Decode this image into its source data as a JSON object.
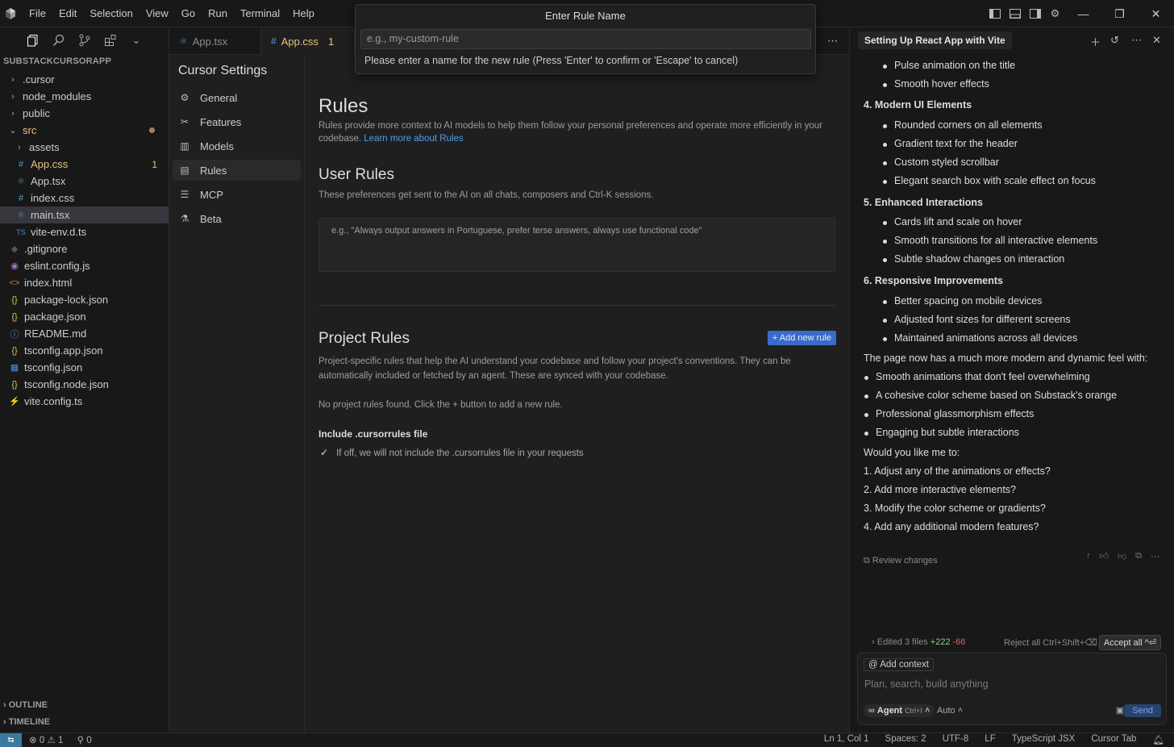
{
  "menu": [
    "File",
    "Edit",
    "Selection",
    "View",
    "Go",
    "Run",
    "Terminal",
    "Help"
  ],
  "explorer": {
    "title": "SUBSTACKCURSORAPP",
    "items": [
      {
        "label": ".cursor",
        "type": "folder",
        "level": 0,
        "icon": "chevron-right"
      },
      {
        "label": "node_modules",
        "type": "folder",
        "level": 0,
        "icon": "chevron-right"
      },
      {
        "label": "public",
        "type": "folder",
        "level": 0,
        "icon": "chevron-right"
      },
      {
        "label": "src",
        "type": "folder-open",
        "level": 0,
        "icon": "chevron-down",
        "color": "#e8c07d"
      },
      {
        "label": "assets",
        "type": "folder",
        "level": 1,
        "icon": "chevron-right"
      },
      {
        "label": "App.css",
        "type": "css",
        "level": 1,
        "badge": "1",
        "color": "#e8c07d"
      },
      {
        "label": "App.tsx",
        "type": "react",
        "level": 1
      },
      {
        "label": "index.css",
        "type": "css",
        "level": 1
      },
      {
        "label": "main.tsx",
        "type": "react",
        "level": 1,
        "selected": true
      },
      {
        "label": "vite-env.d.ts",
        "type": "ts",
        "level": 1
      },
      {
        "label": ".gitignore",
        "type": "git",
        "level": 0
      },
      {
        "label": "eslint.config.js",
        "type": "eslint",
        "level": 0
      },
      {
        "label": "index.html",
        "type": "html",
        "level": 0
      },
      {
        "label": "package-lock.json",
        "type": "json",
        "level": 0
      },
      {
        "label": "package.json",
        "type": "json",
        "level": 0
      },
      {
        "label": "README.md",
        "type": "info",
        "level": 0
      },
      {
        "label": "tsconfig.app.json",
        "type": "json",
        "level": 0
      },
      {
        "label": "tsconfig.json",
        "type": "tsjson",
        "level": 0
      },
      {
        "label": "tsconfig.node.json",
        "type": "json",
        "level": 0
      },
      {
        "label": "vite.config.ts",
        "type": "vite",
        "level": 0
      }
    ],
    "outline": "OUTLINE",
    "timeline": "TIMELINE"
  },
  "tabs": [
    {
      "label": "App.tsx",
      "active": false
    },
    {
      "label": "App.css",
      "badge": "1",
      "active": true
    }
  ],
  "settings": {
    "title": "Cursor Settings",
    "nav": [
      {
        "label": "General",
        "icon": "gear-icon"
      },
      {
        "label": "Features",
        "icon": "tools-icon"
      },
      {
        "label": "Models",
        "icon": "chart-icon"
      },
      {
        "label": "Rules",
        "icon": "document-icon",
        "active": true
      },
      {
        "label": "MCP",
        "icon": "server-icon"
      },
      {
        "label": "Beta",
        "icon": "flask-icon"
      }
    ],
    "rules_heading": "Rules",
    "rules_desc": "Rules provide more context to AI models to help them follow your personal preferences and operate more efficiently in your codebase.",
    "rules_link": "Learn more about Rules",
    "user_rules_heading": "User Rules",
    "user_rules_desc": "These preferences get sent to the AI on all chats, composers and Ctrl-K sessions.",
    "user_rules_placeholder": "e.g., \"Always output answers in Portuguese, prefer terse answers, always use functional code\"",
    "project_rules_heading": "Project Rules",
    "add_rule_label": "+ Add new rule",
    "project_rules_desc": "Project-specific rules that help the AI understand your codebase and follow your project's conventions. They can be automatically included or fetched by an agent. These are synced with your codebase.",
    "no_rules": "No project rules found. Click the + button to add a new rule.",
    "include_heading": "Include .cursorrules file",
    "include_desc": "If off, we will not include the .cursorrules file in your requests"
  },
  "dialog": {
    "title": "Enter Rule Name",
    "placeholder": "e.g., my-custom-rule",
    "message": "Please enter a name for the new rule (Press 'Enter' to confirm or 'Escape' to cancel)"
  },
  "chat": {
    "title": "Setting Up React App with Vite",
    "lines": [
      {
        "kind": "bullet",
        "text": "Pulse animation on the title"
      },
      {
        "kind": "bullet",
        "text": "Smooth hover effects"
      },
      {
        "kind": "head",
        "text": "4. Modern UI Elements"
      },
      {
        "kind": "bullet",
        "text": "Rounded corners on all elements"
      },
      {
        "kind": "bullet",
        "text": "Gradient text for the header"
      },
      {
        "kind": "bullet",
        "text": "Custom styled scrollbar"
      },
      {
        "kind": "bullet",
        "text": "Elegant search box with scale effect on focus"
      },
      {
        "kind": "head",
        "text": "5. Enhanced Interactions"
      },
      {
        "kind": "bullet",
        "text": "Cards lift and scale on hover"
      },
      {
        "kind": "bullet",
        "text": "Smooth transitions for all interactive elements"
      },
      {
        "kind": "bullet",
        "text": "Subtle shadow changes on interaction"
      },
      {
        "kind": "head",
        "text": "6. Responsive Improvements"
      },
      {
        "kind": "bullet",
        "text": "Better spacing on mobile devices"
      },
      {
        "kind": "bullet",
        "text": "Adjusted font sizes for different screens"
      },
      {
        "kind": "bullet",
        "text": "Maintained animations across all devices"
      },
      {
        "kind": "text",
        "text": "The page now has a much more modern and dynamic feel with:"
      },
      {
        "kind": "bullet0",
        "text": "Smooth animations that don't feel overwhelming"
      },
      {
        "kind": "bullet0",
        "text": "A cohesive color scheme based on Substack's orange"
      },
      {
        "kind": "bullet0",
        "text": "Professional glassmorphism effects"
      },
      {
        "kind": "bullet0",
        "text": "Engaging but subtle interactions"
      },
      {
        "kind": "text",
        "text": "Would you like me to:"
      },
      {
        "kind": "num",
        "text": "1. Adjust any of the animations or effects?"
      },
      {
        "kind": "num",
        "text": "2. Add more interactive elements?"
      },
      {
        "kind": "num",
        "text": "3. Modify the color scheme or gradients?"
      },
      {
        "kind": "num",
        "text": "4. Add any additional modern features?"
      }
    ],
    "review": "Review changes",
    "edited": "Edited 3 files",
    "added": "+222",
    "removed": "-66",
    "reject": "Reject all Ctrl+Shift+⌫",
    "accept": "Accept all ^⏎",
    "add_context": "Add context",
    "input_placeholder": "Plan, search, build anything",
    "agent": "Agent",
    "agent_shortcut": "Ctrl+I",
    "mode": "Auto",
    "send": "Send"
  },
  "status": {
    "errors": "0",
    "warnings": "1",
    "ports": "0",
    "right": [
      "Ln 1, Col 1",
      "Spaces: 2",
      "UTF-8",
      "LF",
      "TypeScript JSX",
      "Cursor Tab"
    ]
  }
}
